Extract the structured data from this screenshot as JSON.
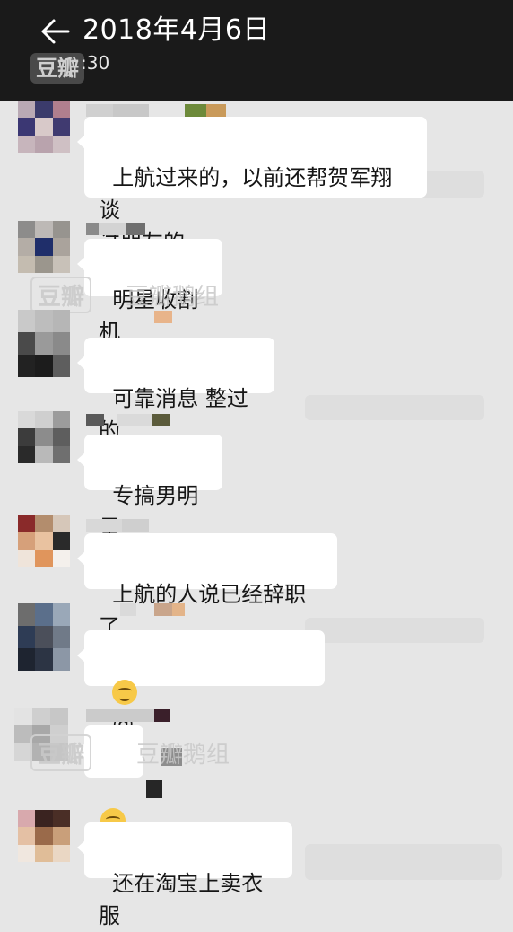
{
  "header": {
    "title": "2018年4月6日",
    "time_fragment": ":30",
    "watermark_logo": "豆瓣",
    "back_icon": "back-arrow-icon"
  },
  "watermarks": {
    "logo": "豆瓣",
    "group_name": "豆瓣鹅组"
  },
  "messages": [
    {
      "text": "上航过来的，以前还帮贺军翔谈\n过朋友的"
    },
    {
      "text": "明星收割机"
    },
    {
      "text": "可靠消息 整过的"
    },
    {
      "text": "专搞男明星"
    },
    {
      "text": "上航的人说已经辞职了"
    },
    {
      "text_at": "@",
      "text_tail": "可靠",
      "emoji": "thinking-emoji"
    },
    {
      "emoji": "hugging-emoji"
    },
    {
      "text": "还在淘宝上卖衣服"
    }
  ],
  "colors": {
    "header_bg": "#1a1a1a",
    "chat_bg": "#e6e6e6",
    "bubble_bg": "#ffffff",
    "text": "#161616"
  }
}
